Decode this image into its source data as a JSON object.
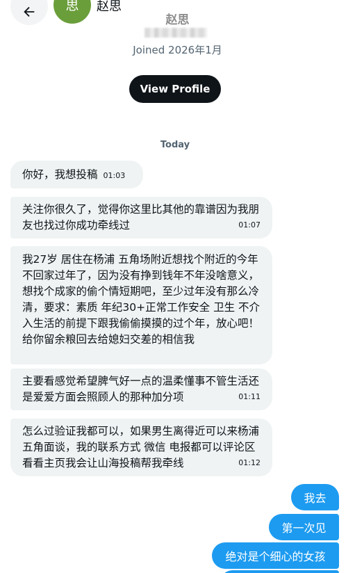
{
  "header": {
    "back_icon": "arrow-left-icon",
    "avatar_text": "思",
    "avatar_color": "#6a9e3a",
    "name": "赵思"
  },
  "profile": {
    "name": "赵思",
    "joined": "Joined 2026年1月",
    "view_profile_label": "View Profile"
  },
  "conversation": {
    "date_separator": "Today",
    "incoming": [
      {
        "text": "你好，我想投稿",
        "time": "01:03"
      },
      {
        "text": "关注你很久了，觉得你这里比其他的靠谱因为我朋友也找过你成功牵线过",
        "time": "01:07"
      },
      {
        "text": "我27岁 居住在杨浦 五角场附近想找个附近的今年不回家过年了，因为没有挣到钱年不年没啥意义，想找个成家的偷个情短期吧，至少过年没有那么冷清，要求：素质 年纪30+正常工作安全 卫生 不介入生活的前提下跟我偷偷摸摸的过个年，放心吧！给你留余粮回去给媳妇交差的相信我",
        "time": ""
      },
      {
        "text": "主要看感觉希望脾气好一点的温柔懂事不管生活还是爱爱方面会照顾人的那种加分项",
        "time": "01:11"
      },
      {
        "text": "怎么过验证我都可以，如果男生离得近可以来杨浦五角面谈，我的联系方式 微信 电报都可以评论区看看主页我会让山海投稿帮我牵线",
        "time": "01:12"
      }
    ],
    "outgoing": [
      {
        "text": "我去"
      },
      {
        "text": "第一次见"
      },
      {
        "text": "绝对是个细心的女孩"
      },
      {
        "text": ""
      }
    ]
  },
  "colors": {
    "outgoing_bubble": "#1d9bf0",
    "incoming_bubble": "#eff3f4",
    "view_profile_button": "#0f1419"
  }
}
